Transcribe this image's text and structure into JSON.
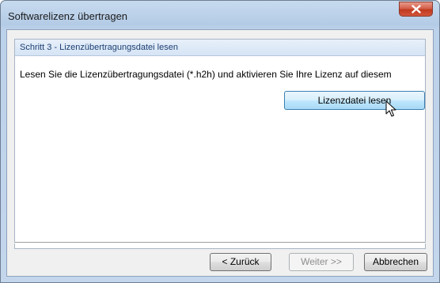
{
  "window": {
    "title": "Softwarelizenz übertragen"
  },
  "step": {
    "header": "Schritt 3 - Lizenzübertragungsdatei lesen",
    "description": "Lesen Sie die Lizenzübertragungsdatei (*.h2h) und aktivieren Sie Ihre Lizenz auf diesem",
    "read_button_label": "Lizenzdatei lesen"
  },
  "footer": {
    "back_label": "< Zurück",
    "next_label": "Weiter >>",
    "cancel_label": "Abbrechen"
  },
  "icons": {
    "close": "close-icon",
    "cursor": "mouse-pointer-icon"
  },
  "colors": {
    "close_button": "#c7432a",
    "accent_button": "#bee6fd",
    "group_header_text": "#1c3f73"
  }
}
